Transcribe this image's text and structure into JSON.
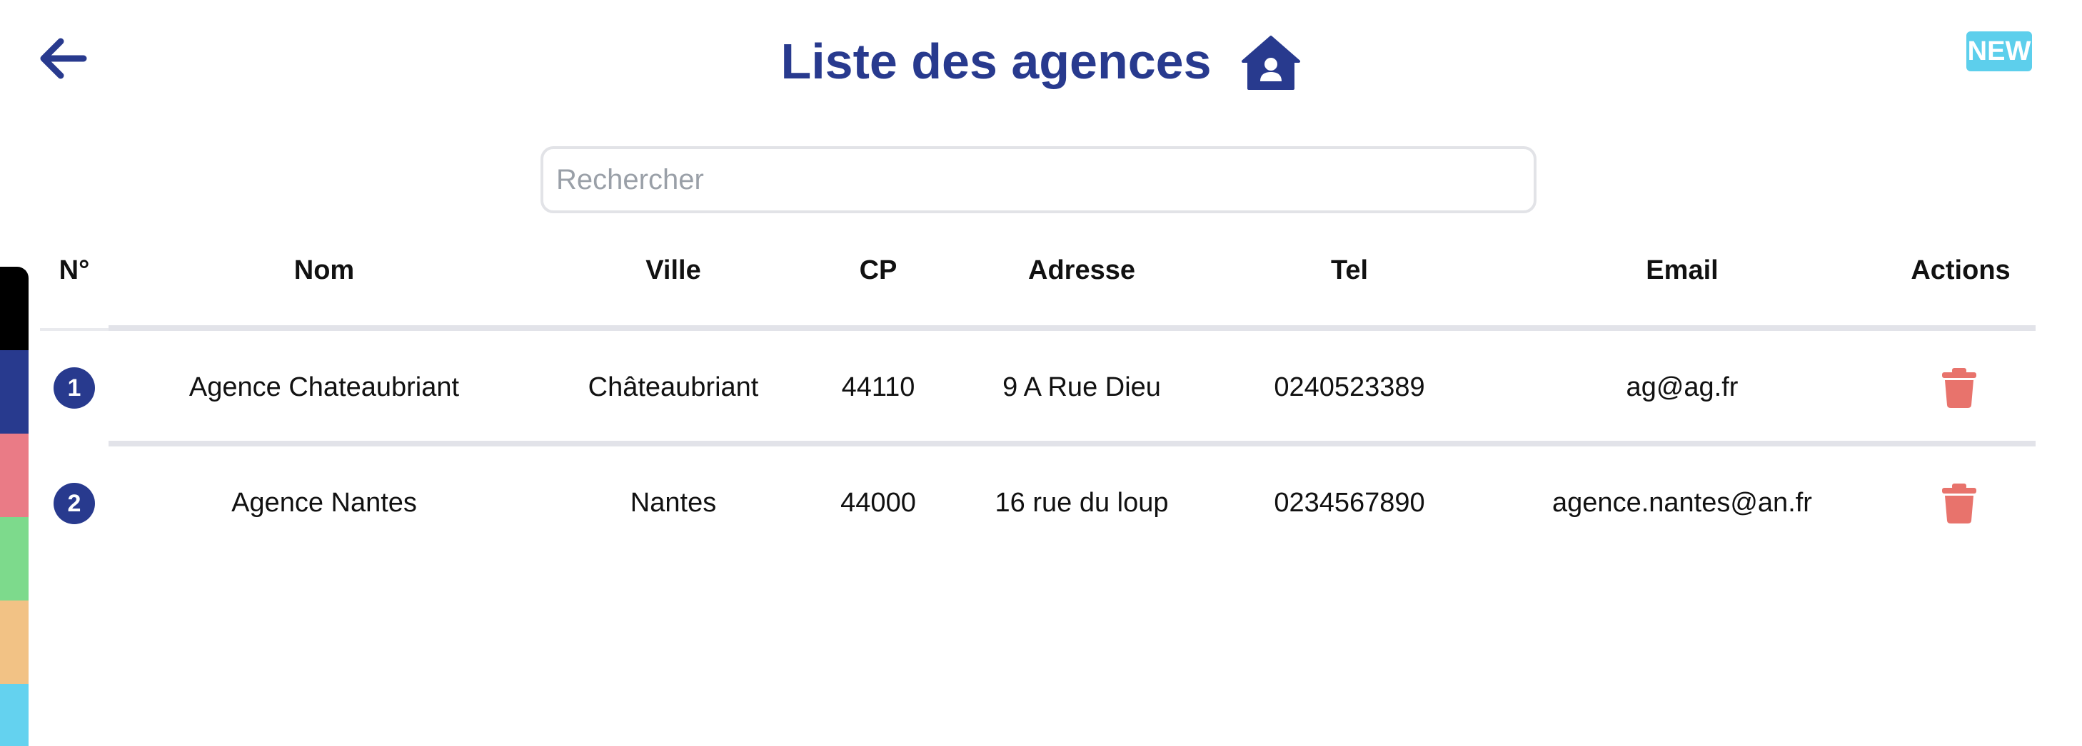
{
  "header": {
    "title": "Liste des agences",
    "back_icon": "arrow-left-icon",
    "title_icon": "house-user-icon",
    "new_label": "NEW"
  },
  "search": {
    "placeholder": "Rechercher",
    "value": ""
  },
  "table": {
    "columns": [
      "N°",
      "Nom",
      "Ville",
      "CP",
      "Adresse",
      "Tel",
      "Email",
      "Actions"
    ],
    "rows": [
      {
        "number": "1",
        "nom": "Agence Chateaubriant",
        "ville": "Châteaubriant",
        "cp": "44110",
        "adresse": "9 A Rue Dieu",
        "tel": "0240523389",
        "email": "ag@ag.fr",
        "action_icon": "trash-icon"
      },
      {
        "number": "2",
        "nom": "Agence Nantes",
        "ville": "Nantes",
        "cp": "44000",
        "adresse": "16 rue du loup",
        "tel": "0234567890",
        "email": "agence.nantes@an.fr",
        "action_icon": "trash-icon"
      }
    ]
  },
  "color_strip": [
    "#000000",
    "#283a8e",
    "#ea7b86",
    "#7dda8c",
    "#f2c285",
    "#64d2ef"
  ],
  "colors": {
    "primary": "#283a8e",
    "accent": "#5dcfec",
    "danger": "#e8736c",
    "divider": "#e2e3e9"
  }
}
